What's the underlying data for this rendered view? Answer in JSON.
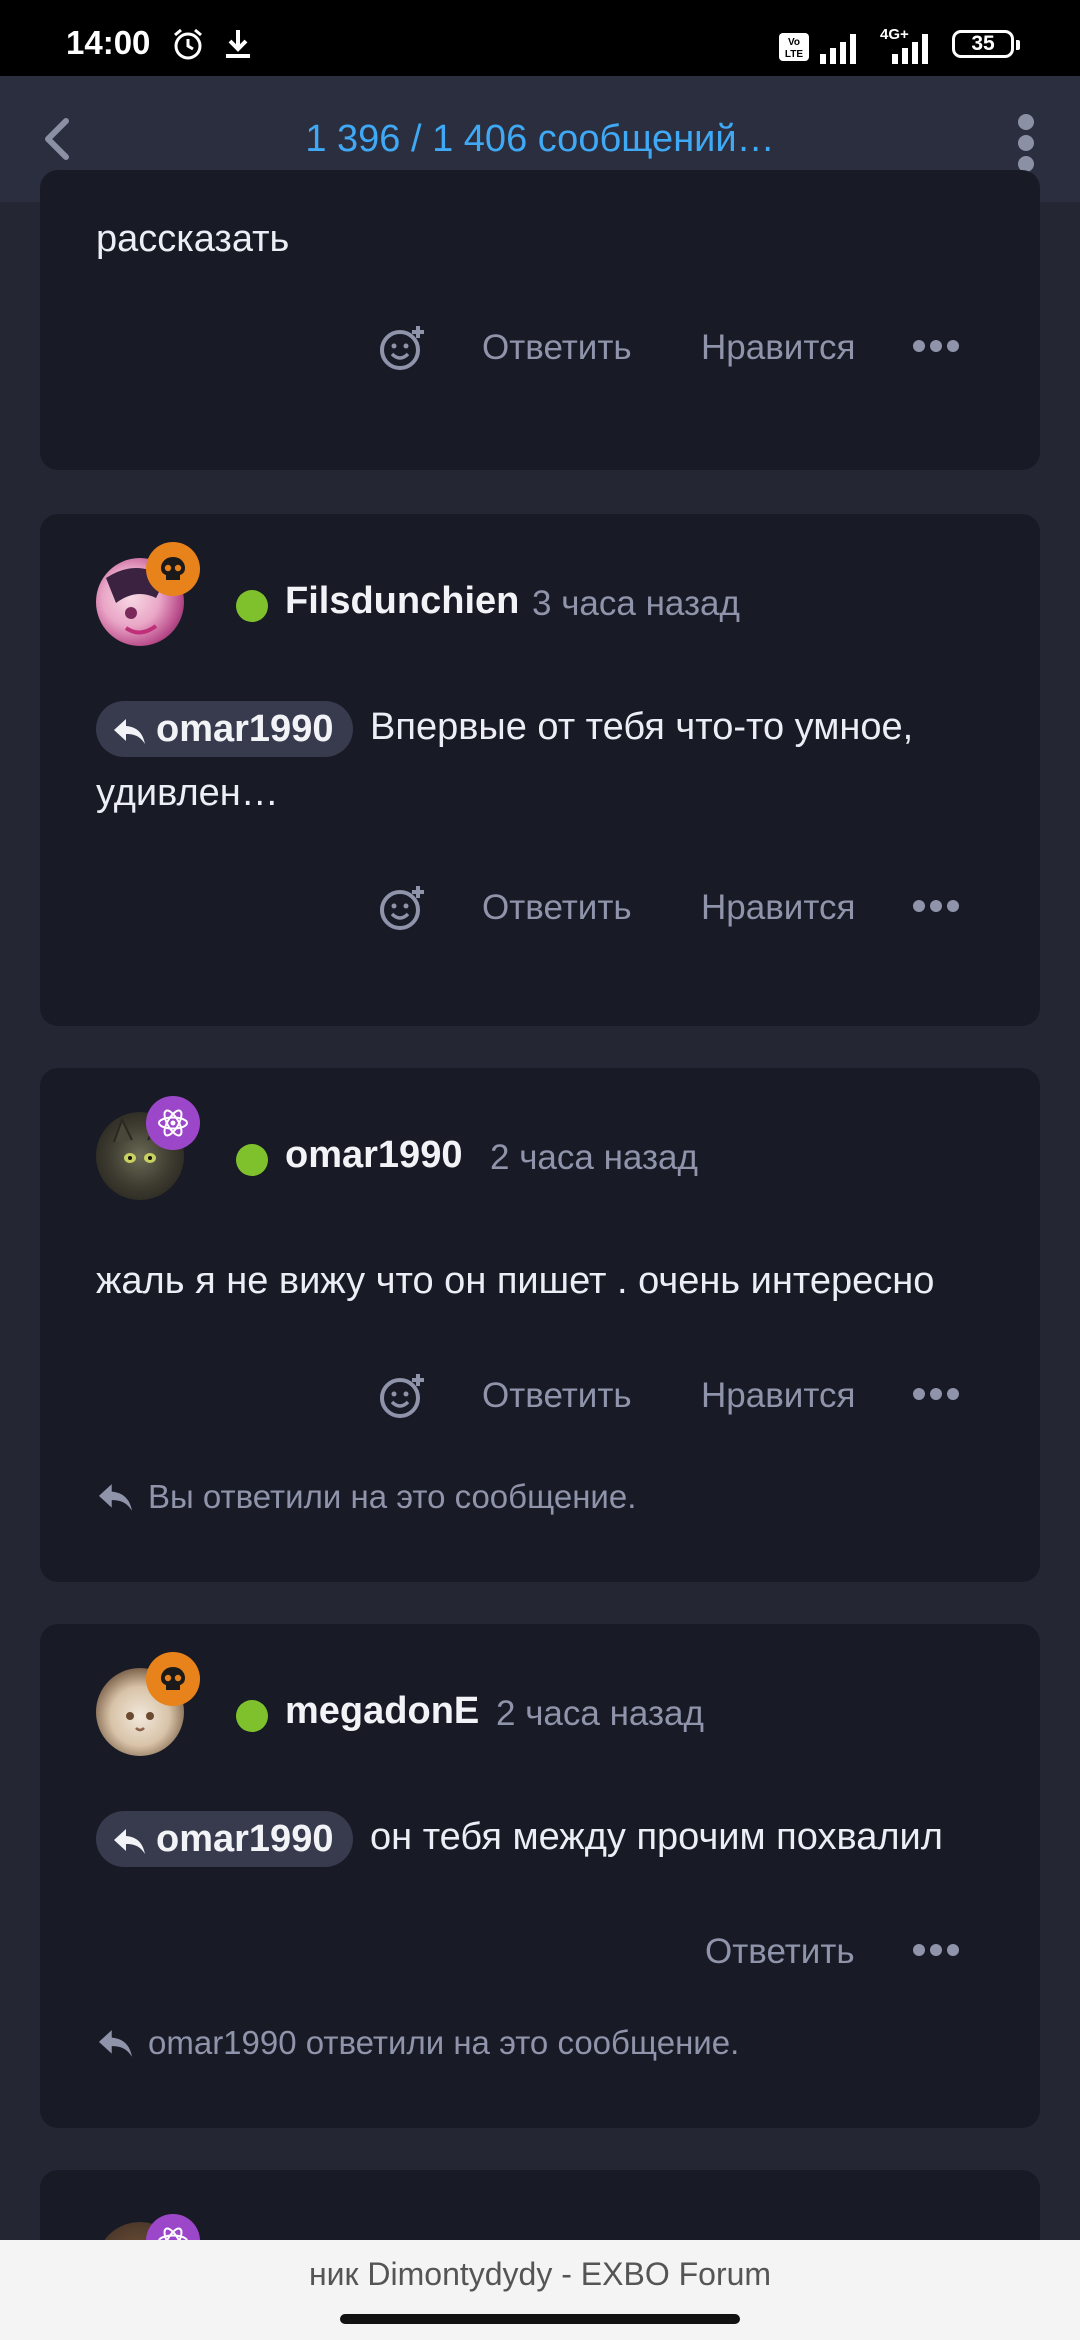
{
  "status_bar": {
    "time": "14:00",
    "icons": [
      "alarm-icon",
      "download-icon",
      "volte-icon",
      "signal-icon",
      "4g-signal-icon"
    ],
    "network_label": "4G+",
    "battery": "35"
  },
  "header": {
    "title": "1 396 / 1 406 сообщений…",
    "back_icon": "chevron-left-icon",
    "menu_icon": "more-vertical-icon"
  },
  "labels": {
    "reply": "Ответить",
    "like": "Нравится"
  },
  "posts": [
    {
      "text": "рассказать",
      "actions": [
        "react",
        "reply",
        "like",
        "more"
      ]
    },
    {
      "username": "Filsdunchien",
      "time": "3 часа назад",
      "badge_icon": "skull-icon",
      "badge_color": "#e8821a",
      "online": true,
      "mention": "omar1990",
      "text": "Впервые от тебя что-то умное, удивлен…",
      "actions": [
        "react",
        "reply",
        "like",
        "more"
      ]
    },
    {
      "username": "omar1990",
      "time": "2 часа назад",
      "badge_icon": "atom-icon",
      "badge_color": "#9c47c9",
      "online": true,
      "text": "жаль я не вижу что он пишет . очень интересно",
      "actions": [
        "react",
        "reply",
        "like",
        "more"
      ],
      "replied_note": "Вы ответили на это сообщение."
    },
    {
      "username": "megadonE",
      "time": "2 часа назад",
      "badge_icon": "skull-icon",
      "badge_color": "#e8821a",
      "online": true,
      "mention": "omar1990",
      "text": "он тебя между прочим похвалил",
      "actions": [
        "reply",
        "more"
      ],
      "replied_note": "omar1990 ответили на это сообщение."
    }
  ],
  "colors": {
    "background": "#242634",
    "card": "#181a25",
    "accent": "#3fa9f5",
    "online": "#7ec12d",
    "muted_text": "#8f94ab"
  },
  "browser_bar": {
    "title": "ник Dimontydydy - EXBO Forum"
  }
}
